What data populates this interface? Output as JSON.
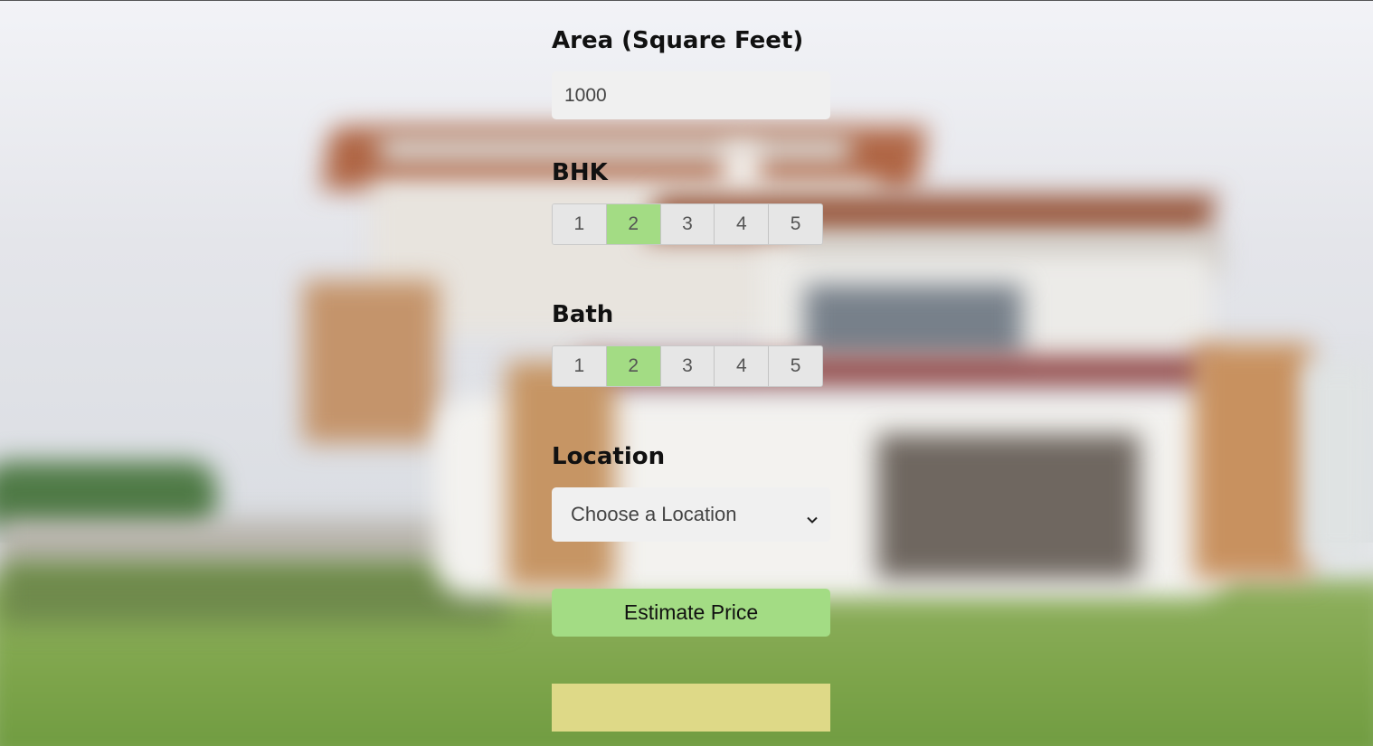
{
  "form": {
    "area_label": "Area (Square Feet)",
    "area_value": "1000",
    "bhk_label": "BHK",
    "bhk_options": [
      "1",
      "2",
      "3",
      "4",
      "5"
    ],
    "bhk_selected": "2",
    "bath_label": "Bath",
    "bath_options": [
      "1",
      "2",
      "3",
      "4",
      "5"
    ],
    "bath_selected": "2",
    "location_label": "Location",
    "location_placeholder": "Choose a Location",
    "estimate_button": "Estimate Price",
    "result_text": ""
  },
  "colors": {
    "selected_option": "#a3dc84",
    "button": "#a3dc84",
    "result_box": "#ded987",
    "input_bg": "#f0f0f0"
  },
  "icons": {
    "location_dropdown": "chevron-down-icon"
  }
}
